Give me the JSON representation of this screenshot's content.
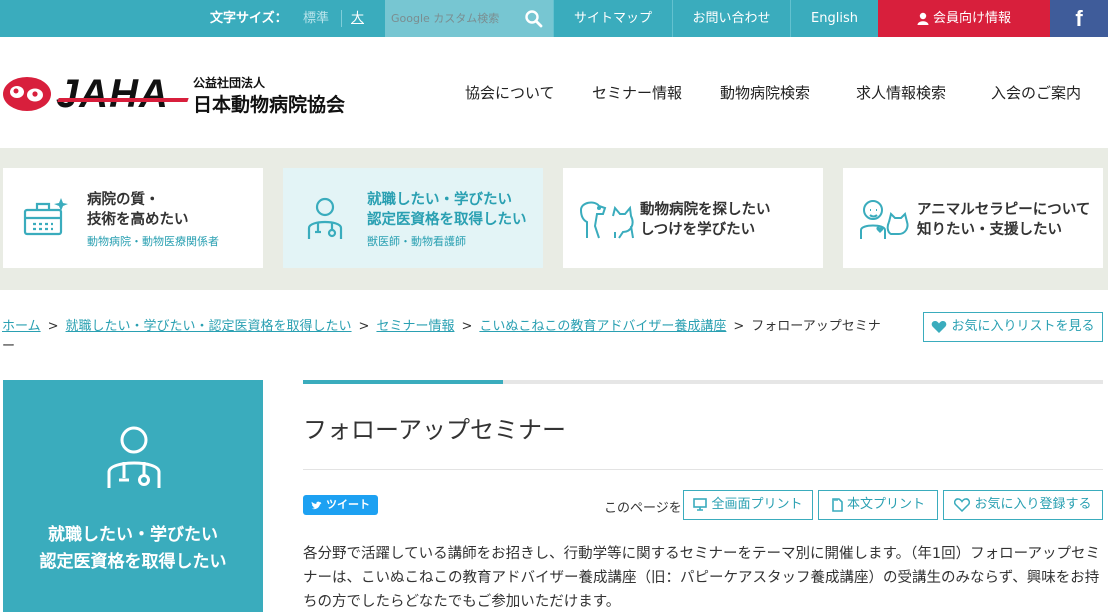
{
  "topbar": {
    "font_size_label": "文字サイズ：",
    "font_standard": "標準",
    "font_large": "大",
    "search_placeholder": "Google カスタム検索",
    "sitemap": "サイトマップ",
    "contact": "お問い合わせ",
    "english": "English",
    "member": "会員向け情報",
    "facebook": "f"
  },
  "logo": {
    "wordmark": "JAHA",
    "org_type": "公益社団法人",
    "org_name": "日本動物病院協会"
  },
  "global_nav": [
    "協会について",
    "セミナー情報",
    "動物病院検索",
    "求人情報検索",
    "入会のご案内"
  ],
  "categories": [
    {
      "title1": "病院の質・",
      "title2": "技術を高めたい",
      "sub": "動物病院・動物医療関係者",
      "icon": "hospital-icon"
    },
    {
      "title1": "就職したい・学びたい",
      "title2": "認定医資格を取得したい",
      "sub": "獣医師・動物看護師",
      "icon": "doctor-icon"
    },
    {
      "title1": "動物病院を探したい",
      "title2": "しつけを学びたい",
      "sub": "",
      "icon": "dog-cat-icon"
    },
    {
      "title1": "アニマルセラピーについて",
      "title2": "知りたい・支援したい",
      "sub": "",
      "icon": "therapy-icon"
    }
  ],
  "breadcrumb": {
    "home": "ホーム",
    "level1": "就職したい・学びたい・認定医資格を取得したい",
    "level2": "セミナー情報",
    "level3": "こいぬこねこの教育アドバイザー養成講座",
    "current": "フォローアップセミナー",
    "separator": ">"
  },
  "favorites_list_button": "お気に入りリストを見る",
  "sidebar": {
    "title1": "就職したい・学びたい",
    "title2": "認定医資格を取得したい"
  },
  "page": {
    "title": "フォローアップセミナー",
    "tweet": "ツイート",
    "this_page": "このページを",
    "print_full": "全画面プリント",
    "print_body": "本文プリント",
    "add_favorite": "お気に入り登録する",
    "body": "各分野で活躍している講師をお招きし、行動学等に関するセミナーをテーマ別に開催します。（年1回）フォローアップセミナーは、こいぬこねこの教育アドバイザー養成講座（旧：パピーケアスタッフ養成講座）の受講生のみならず、興味をお持ちの方でしたらどなたでもご参加いただけます。"
  },
  "colors": {
    "teal": "#3aacbd",
    "red": "#d81f3c",
    "facebook": "#3f5c9a",
    "band": "#e9ece4"
  }
}
